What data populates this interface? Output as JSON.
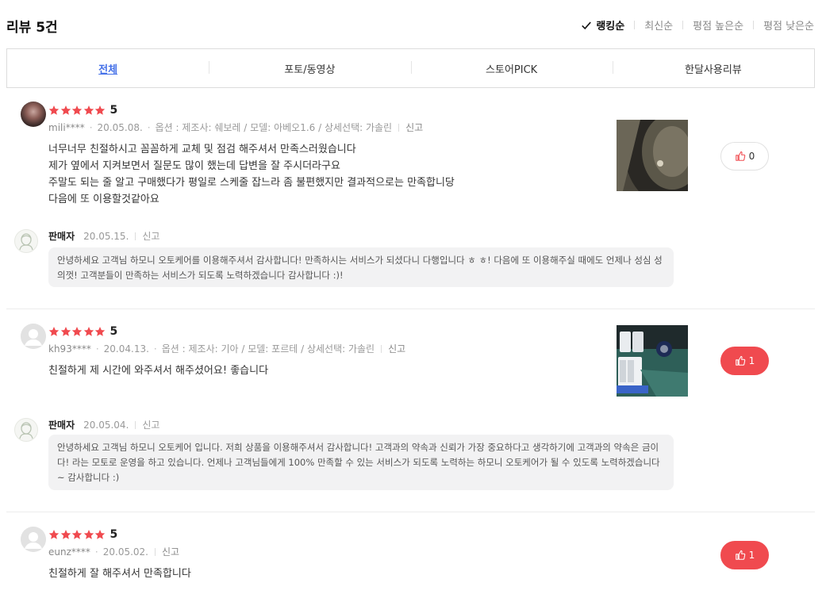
{
  "header": {
    "title": "리뷰 5건",
    "sort_options": [
      "랭킹순",
      "최신순",
      "평점 높은순",
      "평점 낮은순"
    ]
  },
  "tabs": [
    "전체",
    "포토/동영상",
    "스토어PICK",
    "한달사용리뷰"
  ],
  "colors": {
    "accent": "#4470e8",
    "star": "#f04a4f",
    "like_active": "#f04a4f"
  },
  "reviews": [
    {
      "score": "5",
      "user": "mili****",
      "date": "20.05.08.",
      "option": "옵션 : 제조사: 쉐보레 / 모델: 아베오1.6 / 상세선택: 가솔린",
      "report": "신고",
      "lines": [
        "너무너무 친절하시고 꼼꼼하게 교체 및 점검 해주셔서 만족스러웠습니다",
        "제가 옆에서 지켜보면서 질문도 많이 했는데 답변을 잘 주시더라구요",
        "주말도 되는 줄 알고 구매했다가 평일로 스케줄 잡느라 좀 불편했지만 결과적으로는 만족합니당",
        "다음에 또 이용할것같아요"
      ],
      "likes": "0",
      "reply": {
        "name": "판매자",
        "date": "20.05.15.",
        "report": "신고",
        "text": "안녕하세요 고객님 하모니 오토케어를 이용해주셔서 감사합니다! 만족하시는 서비스가 되셨다니 다행입니다 ㅎ ㅎ! 다음에 또 이용해주실 때에도 언제나 성심 성의껏! 고객분들이 만족하는 서비스가 되도록 노력하겠습니다 감사합니다 :)!"
      }
    },
    {
      "score": "5",
      "user": "kh93****",
      "date": "20.04.13.",
      "option": "옵션 : 제조사: 기아 / 모델: 포르테 / 상세선택: 가솔린",
      "report": "신고",
      "lines": [
        "친절하게 제 시간에 와주셔서 해주셨어요! 좋습니다"
      ],
      "likes": "1",
      "reply": {
        "name": "판매자",
        "date": "20.05.04.",
        "report": "신고",
        "text": "안녕하세요 고객님 하모니 오토케어 입니다. 저희 상품을 이용해주셔서 감사합니다! 고객과의 약속과 신뢰가 가장 중요하다고 생각하기에 고객과의 약속은 금이다! 라는 모토로 운영을 하고 있습니다. 언제나 고객님들에게 100% 만족할 수 있는 서비스가 되도록 노력하는 하모니 오토케어가 될 수 있도록 노력하겠습니다~ 감사합니다 :)"
      }
    },
    {
      "score": "5",
      "user": "eunz****",
      "date": "20.05.02.",
      "report": "신고",
      "lines": [
        "친절하게 잘 해주셔서 만족합니다"
      ],
      "likes": "1"
    }
  ]
}
